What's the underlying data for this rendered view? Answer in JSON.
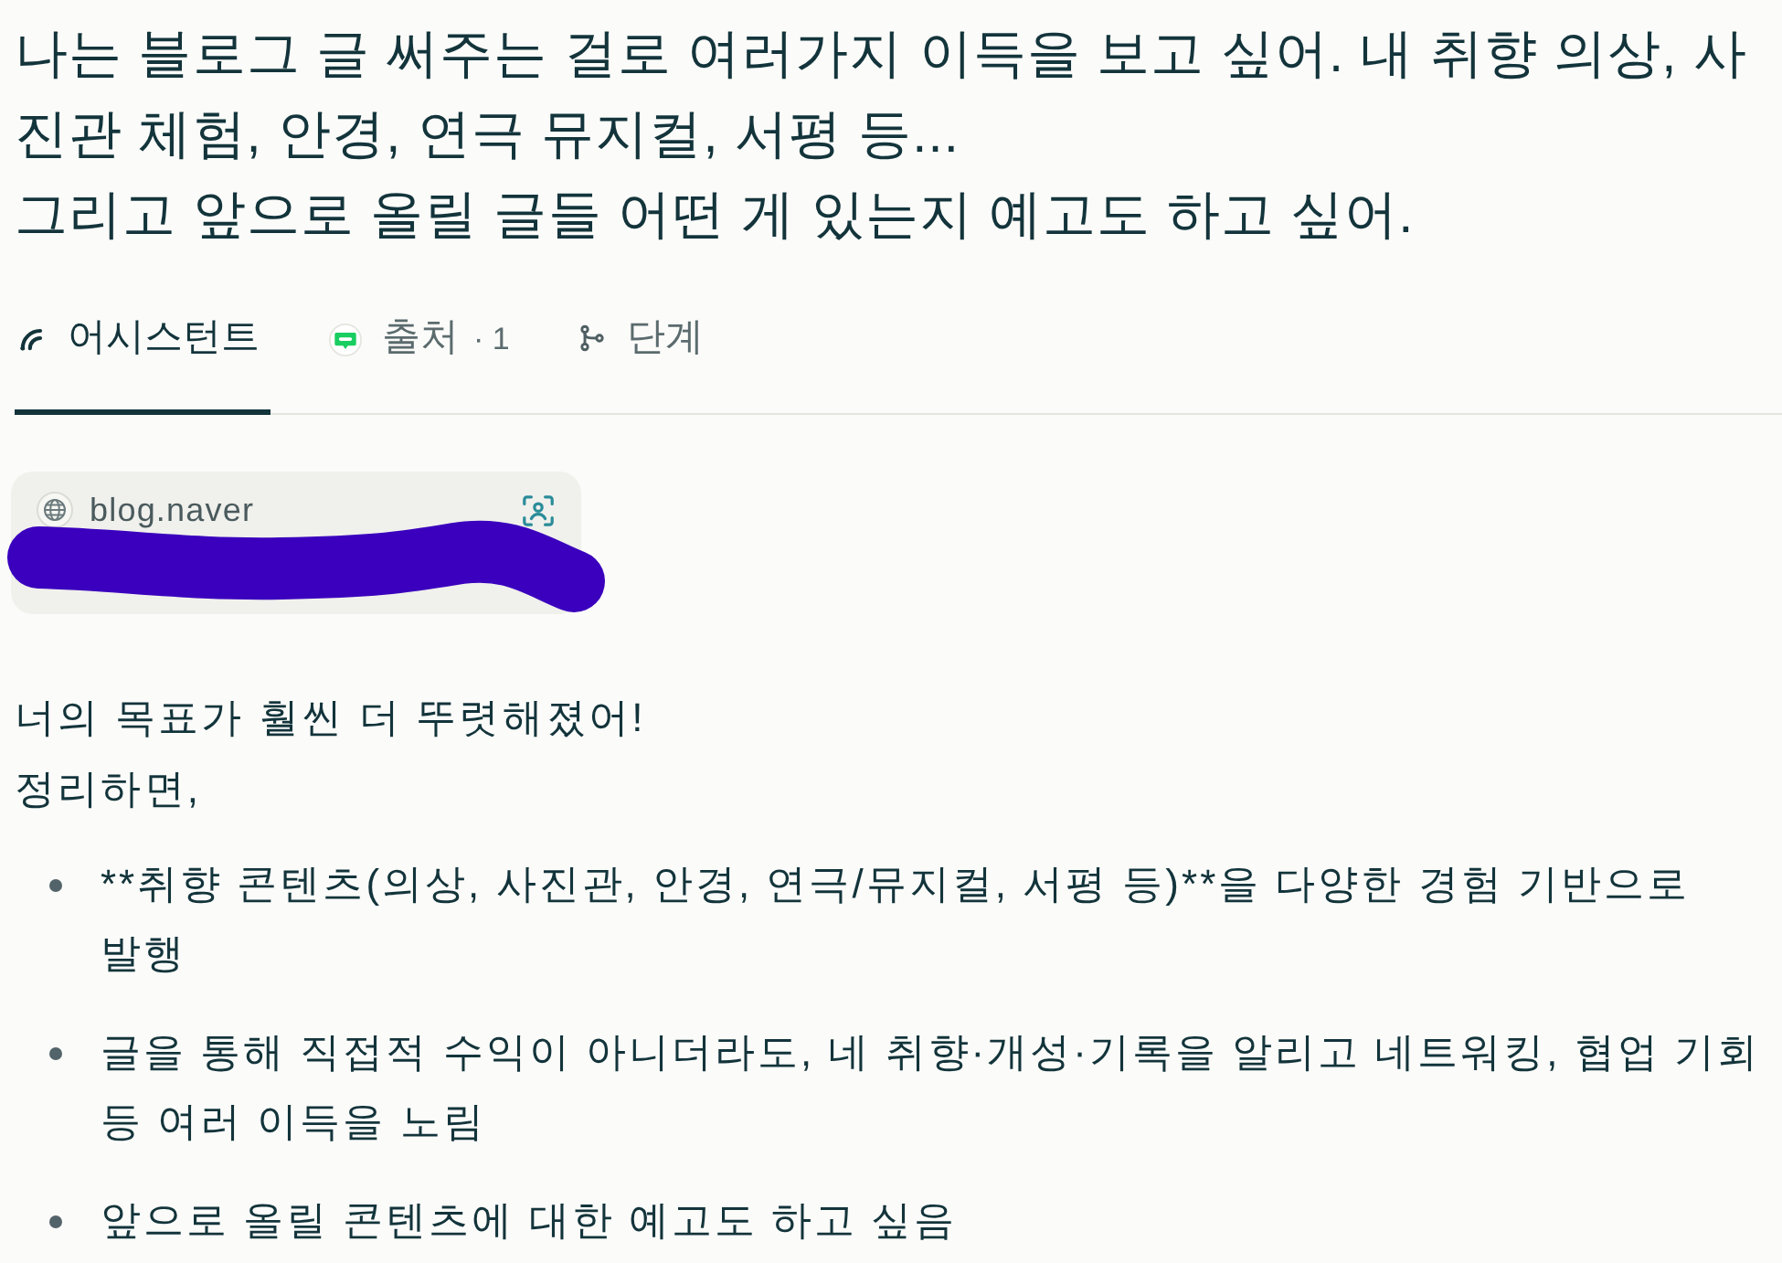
{
  "query": {
    "lines": [
      "나는 블로그 글 써주는 걸로 여러가지 이득을 보고 싶어. 내 취향 의상, 사진관 체험, 안경, 연극 뮤지컬, 서평 등...",
      "그리고 앞으로 올릴 글들 어떤 게 있는지 예고도 하고 싶어."
    ]
  },
  "tabs": [
    {
      "kind": "assistant",
      "label": "어시스턴트",
      "selected": true
    },
    {
      "kind": "sources",
      "label": "출처",
      "count": "· 1",
      "selected": false
    },
    {
      "kind": "steps",
      "label": "단계",
      "selected": false
    }
  ],
  "sources": [
    {
      "domain": "blog.naver"
    }
  ],
  "answer": {
    "paragraphs": [
      "너의 목표가 훨씬 더 뚜렷해졌어!",
      "정리하면,"
    ],
    "bullets": [
      "**취향 콘텐츠(의상, 사진관, 안경, 연극/뮤지컬, 서평 등)**을 다양한 경험 기반으로 발행",
      "글을 통해 직접적 수익이 아니더라도, 네 취향·개성·기록을 알리고 네트워킹, 협업 기회 등 여러 이득을 노림",
      "앞으로 올릴 콘텐츠에 대한 예고도 하고 싶음"
    ]
  }
}
